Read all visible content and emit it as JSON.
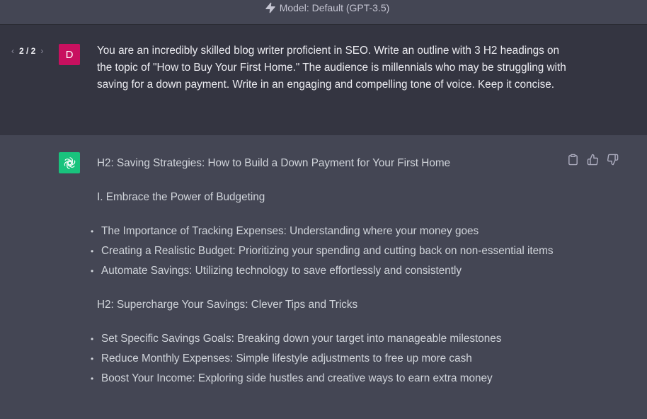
{
  "header": {
    "model_label": "Model: Default (GPT-3.5)"
  },
  "user_message": {
    "pager": "2 / 2",
    "avatar_initial": "D",
    "text": "You are an incredibly skilled blog writer proficient in SEO. Write an outline with 3 H2 headings on the topic of \"How to Buy Your First Home.\" The audience is millennials who may be struggling with saving for a down payment. Write in an engaging and compelling tone of voice. Keep it concise."
  },
  "assistant_message": {
    "heading_1": "H2: Saving Strategies: How to Build a Down Payment for Your First Home",
    "subheading_1": "I. Embrace the Power of Budgeting",
    "list_1": [
      "The Importance of Tracking Expenses: Understanding where your money goes",
      "Creating a Realistic Budget: Prioritizing your spending and cutting back on non-essential items",
      "Automate Savings: Utilizing technology to save effortlessly and consistently"
    ],
    "heading_2": "H2: Supercharge Your Savings: Clever Tips and Tricks",
    "list_2": [
      "Set Specific Savings Goals: Breaking down your target into manageable milestones",
      "Reduce Monthly Expenses: Simple lifestyle adjustments to free up more cash",
      "Boost Your Income: Exploring side hustles and creative ways to earn extra money"
    ]
  },
  "icons": {
    "model": "bolt-icon",
    "copy": "clipboard-icon",
    "like": "thumbs-up-icon",
    "dislike": "thumbs-down-icon",
    "assistant_avatar": "openai-logo-icon"
  },
  "colors": {
    "user_avatar": "#c8105f",
    "assistant_avatar": "#19c37d",
    "user_bg": "#343541",
    "assistant_bg": "#444654"
  }
}
